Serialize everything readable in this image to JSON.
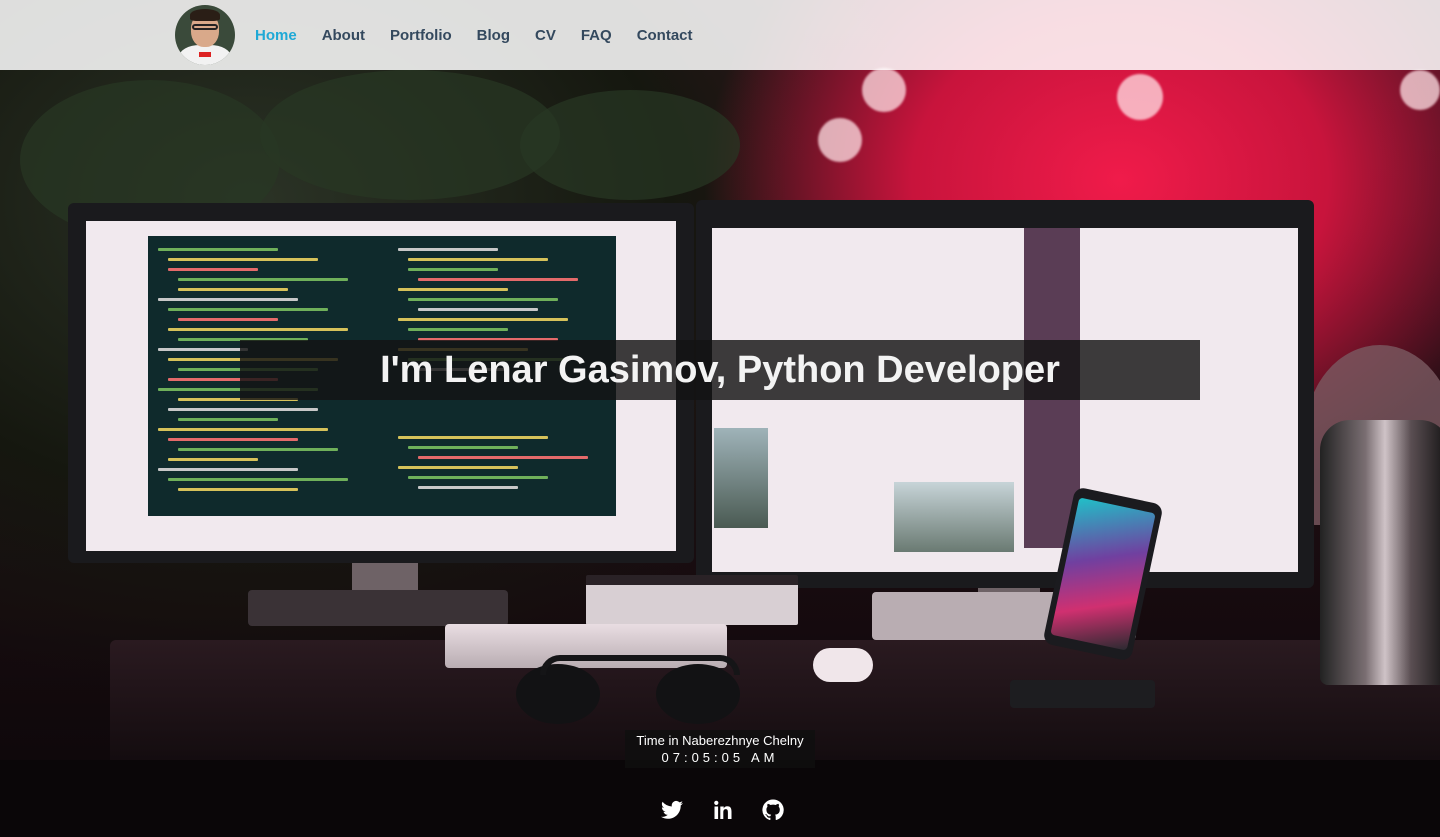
{
  "nav": {
    "avatar_alt": "profile photo",
    "items": [
      {
        "label": "Home",
        "active": true
      },
      {
        "label": "About",
        "active": false
      },
      {
        "label": "Portfolio",
        "active": false
      },
      {
        "label": "Blog",
        "active": false
      },
      {
        "label": "CV",
        "active": false
      },
      {
        "label": "FAQ",
        "active": false
      },
      {
        "label": "Contact",
        "active": false
      }
    ]
  },
  "hero": {
    "headline": "I'm Lenar Gasimov, Python Developer"
  },
  "clock": {
    "label": "Time in Naberezhnye Chelny",
    "time": "07:05:05 AM"
  },
  "social": [
    {
      "icon": "twitter-icon"
    },
    {
      "icon": "linkedin-icon"
    },
    {
      "icon": "github-icon"
    }
  ],
  "colors": {
    "nav_active": "#1fa9d6",
    "nav_text": "#34495e",
    "accent_background": "#e8173f"
  }
}
